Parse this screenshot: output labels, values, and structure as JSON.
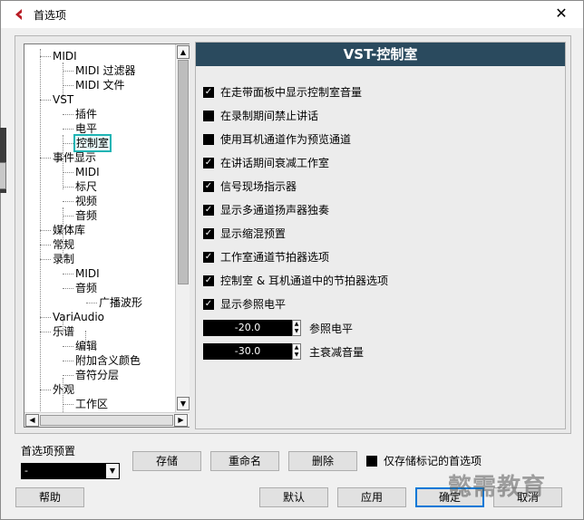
{
  "window": {
    "title": "首选项"
  },
  "tree": {
    "items": [
      {
        "label": "MIDI",
        "level": 1
      },
      {
        "label": "MIDI 过滤器",
        "level": 2
      },
      {
        "label": "MIDI 文件",
        "level": 2
      },
      {
        "label": "VST",
        "level": 1
      },
      {
        "label": "插件",
        "level": 2
      },
      {
        "label": "电平",
        "level": 2
      },
      {
        "label": "控制室",
        "level": 2,
        "selected": true
      },
      {
        "label": "事件显示",
        "level": 1
      },
      {
        "label": "MIDI",
        "level": 2
      },
      {
        "label": "标尺",
        "level": 2
      },
      {
        "label": "视频",
        "level": 2
      },
      {
        "label": "音频",
        "level": 2
      },
      {
        "label": "媒体库",
        "level": 1
      },
      {
        "label": "常规",
        "level": 1
      },
      {
        "label": "录制",
        "level": 1
      },
      {
        "label": "MIDI",
        "level": 2
      },
      {
        "label": "音频",
        "level": 2
      },
      {
        "label": "广播波形",
        "level": 3
      },
      {
        "label": "VariAudio",
        "level": 1
      },
      {
        "label": "乐谱",
        "level": 1
      },
      {
        "label": "编辑",
        "level": 2
      },
      {
        "label": "附加含义颜色",
        "level": 2
      },
      {
        "label": "音符分层",
        "level": 2
      },
      {
        "label": "外观",
        "level": 1
      },
      {
        "label": "工作区",
        "level": 2
      }
    ]
  },
  "panel": {
    "title": "VST-控制室",
    "options": [
      {
        "label": "在走带面板中显示控制室音量",
        "checked": true
      },
      {
        "label": "在录制期间禁止讲话",
        "checked": false
      },
      {
        "label": "使用耳机通道作为预览通道",
        "checked": false
      },
      {
        "label": "在讲话期间衰减工作室",
        "checked": true
      },
      {
        "label": "信号现场指示器",
        "checked": true
      },
      {
        "label": "显示多通道扬声器独奏",
        "checked": true
      },
      {
        "label": "显示缩混预置",
        "checked": true
      },
      {
        "label": "工作室通道节拍器选项",
        "checked": true
      },
      {
        "label": "控制室 & 耳机通道中的节拍器选项",
        "checked": true
      },
      {
        "label": "显示参照电平",
        "checked": true
      }
    ],
    "reference_level": {
      "value": "-20.0",
      "label": "参照电平"
    },
    "main_dim": {
      "value": "-30.0",
      "label": "主衰减音量"
    }
  },
  "presets": {
    "label": "首选项预置",
    "selected": "-",
    "store_label": "存储",
    "rename_label": "重命名",
    "delete_label": "删除",
    "only_marked_label": "仅存储标记的首选项",
    "only_marked_checked": false
  },
  "footer": {
    "help_label": "帮助",
    "default_label": "默认",
    "apply_label": "应用",
    "ok_label": "确定",
    "cancel_label": "取消"
  },
  "watermark": "懿需教育"
}
